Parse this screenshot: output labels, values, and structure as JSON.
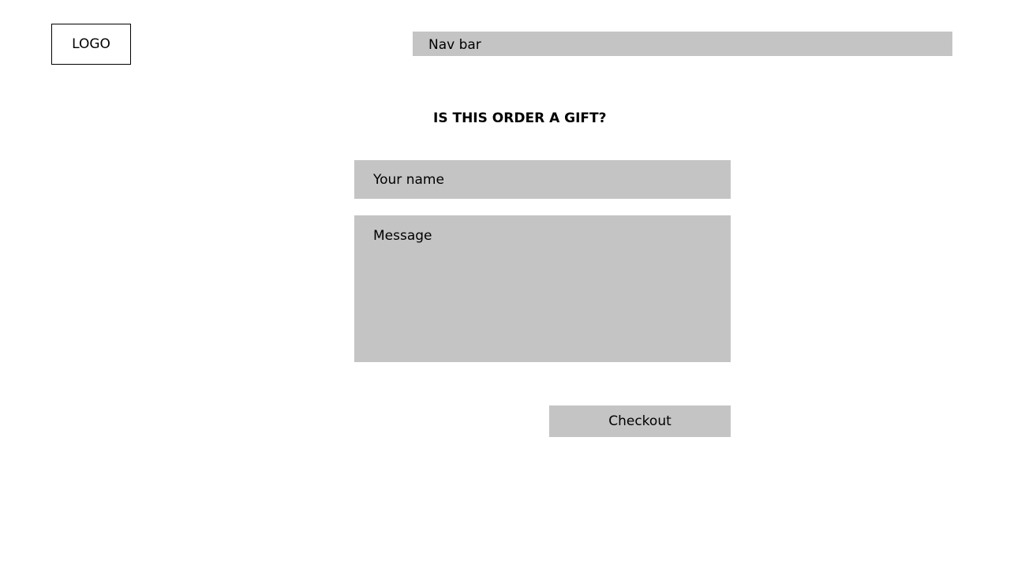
{
  "header": {
    "logo_label": "LOGO",
    "nav_label": "Nav bar"
  },
  "gift_form": {
    "heading": "IS THIS ORDER A GIFT?",
    "name_placeholder": "Your name",
    "message_placeholder": "Message",
    "checkout_label": "Checkout"
  },
  "colors": {
    "placeholder_fill": "#c4c4c4",
    "text": "#000000",
    "background": "#ffffff"
  }
}
